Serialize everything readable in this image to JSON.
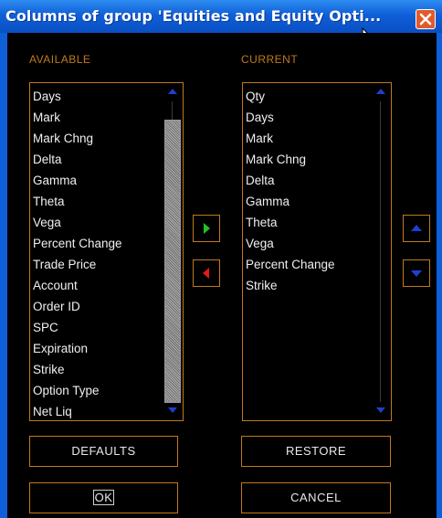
{
  "window": {
    "title": "Columns of group 'Equities and Equity Opti..."
  },
  "available": {
    "label": "AVAILABLE",
    "items": [
      "Days",
      "Mark",
      "Mark Chng",
      "Delta",
      "Gamma",
      "Theta",
      "Vega",
      "Percent Change",
      "Trade Price",
      "Account",
      "Order ID",
      "SPC",
      "Expiration",
      "Strike",
      "Option Type",
      "Net Liq"
    ]
  },
  "current": {
    "label": "CURRENT",
    "items": [
      "Qty",
      "Days",
      "Mark",
      "Mark Chng",
      "Delta",
      "Gamma",
      "Theta",
      "Vega",
      "Percent Change",
      "Strike"
    ]
  },
  "buttons": {
    "defaults": "DEFAULTS",
    "restore": "RESTORE",
    "ok": "OK",
    "cancel": "CANCEL"
  },
  "colors": {
    "accent": "#c07a1c",
    "titlebar": "#0f5fd8",
    "add_arrow": "#22c322",
    "remove_arrow": "#e21a1a",
    "scroll_arrow": "#1f3fd0"
  },
  "icons": {
    "close": "close-icon",
    "add": "arrow-right-icon",
    "remove": "arrow-left-icon",
    "move_up": "arrow-up-icon",
    "move_down": "arrow-down-icon"
  }
}
